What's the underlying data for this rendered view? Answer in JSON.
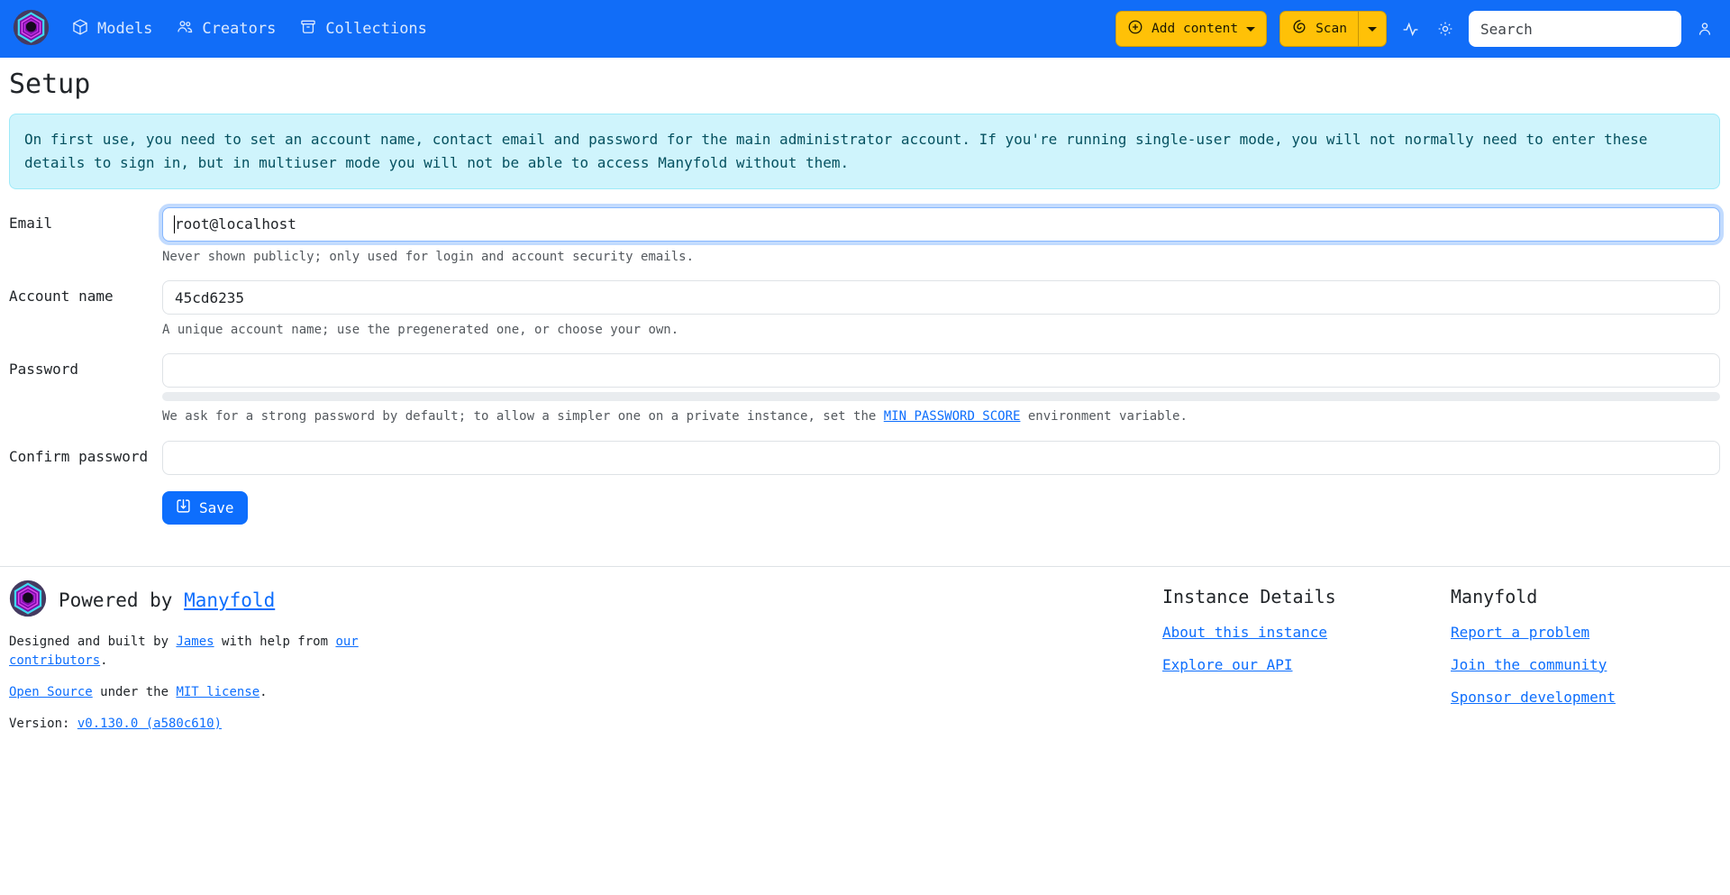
{
  "colors": {
    "navbar_bg": "#116df8",
    "accent_primary": "#0d6efd",
    "warning_button": "#ffc107",
    "alert_bg": "#cff4fc",
    "alert_text": "#055160",
    "link": "#0d6efd"
  },
  "icons": {
    "logo": "manyfold-hexagon-logo",
    "models": "cube-outline",
    "creators": "people",
    "collections": "archive-box",
    "add_content": "plus-circle",
    "scan": "spiral",
    "activity": "pulse-line",
    "settings": "gear",
    "profile": "person-silhouette",
    "save": "box-arrow-in-down"
  },
  "navbar": {
    "items": [
      {
        "label": "Models"
      },
      {
        "label": "Creators"
      },
      {
        "label": "Collections"
      }
    ],
    "add_content_label": "Add content",
    "scan_label": "Scan",
    "search_placeholder": "Search"
  },
  "page": {
    "title": "Setup"
  },
  "alert": {
    "text": "On first use, you need to set an account name, contact email and password for the main administrator account. If you're running single-user mode, you will not normally need to enter these details to sign in, but in multiuser mode you will not be able to access Manyfold without them."
  },
  "form": {
    "email": {
      "label": "Email",
      "value": "root@localhost",
      "help": "Never shown publicly; only used for login and account security emails."
    },
    "account": {
      "label": "Account name",
      "value": "45cd6235",
      "help": "A unique account name; use the pregenerated one, or choose your own."
    },
    "password": {
      "label": "Password",
      "help_before": "We ask for a strong password by default; to allow a simpler one on a private instance, set the ",
      "help_link": "MIN PASSWORD SCORE",
      "help_after": " environment variable."
    },
    "confirm": {
      "label": "Confirm password"
    },
    "save_label": "Save"
  },
  "footer": {
    "powered_prefix": "Powered by ",
    "powered_link": "Manyfold",
    "credits": {
      "prefix": "Designed and built by ",
      "james_link": "James",
      "middle": " with help from ",
      "contributors_link": "our contributors",
      "suffix": "."
    },
    "license": {
      "open_source_link": "Open Source",
      "middle": " under the ",
      "mit_link": "MIT license",
      "suffix": "."
    },
    "version_label": "Version: ",
    "version_link": "v0.130.0 (a580c610)",
    "instance": {
      "heading": "Instance Details",
      "links": [
        "About this instance",
        "Explore our API"
      ]
    },
    "manyfold": {
      "heading": "Manyfold",
      "links": [
        "Report a problem",
        "Join the community",
        "Sponsor development"
      ]
    }
  }
}
